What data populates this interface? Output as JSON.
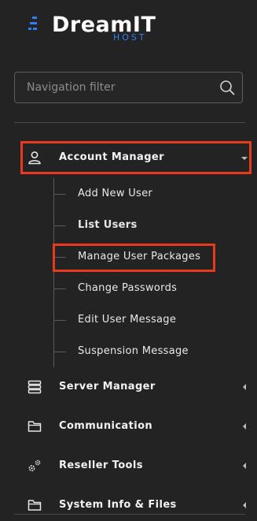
{
  "logo": {
    "text": "DreamIT",
    "subtext": "HOST",
    "accent": "#2d7ff9"
  },
  "filter": {
    "placeholder": "Navigation filter",
    "value": ""
  },
  "colors": {
    "background": "#232323",
    "highlight": "#e8391b"
  },
  "nav": {
    "account_manager": {
      "label": "Account Manager",
      "icon": "user-icon",
      "expanded": true,
      "items": [
        {
          "label": "Add New User"
        },
        {
          "label": "List Users",
          "bold": true
        },
        {
          "label": "Manage User Packages",
          "highlighted": true
        },
        {
          "label": "Change Passwords"
        },
        {
          "label": "Edit User Message"
        },
        {
          "label": "Suspension Message"
        }
      ]
    },
    "server_manager": {
      "label": "Server Manager",
      "icon": "server-icon"
    },
    "communication": {
      "label": "Communication",
      "icon": "folder-icon"
    },
    "reseller_tools": {
      "label": "Reseller Tools",
      "icon": "gears-icon"
    },
    "system_info": {
      "label": "System Info & Files",
      "icon": "folder-icon"
    }
  }
}
